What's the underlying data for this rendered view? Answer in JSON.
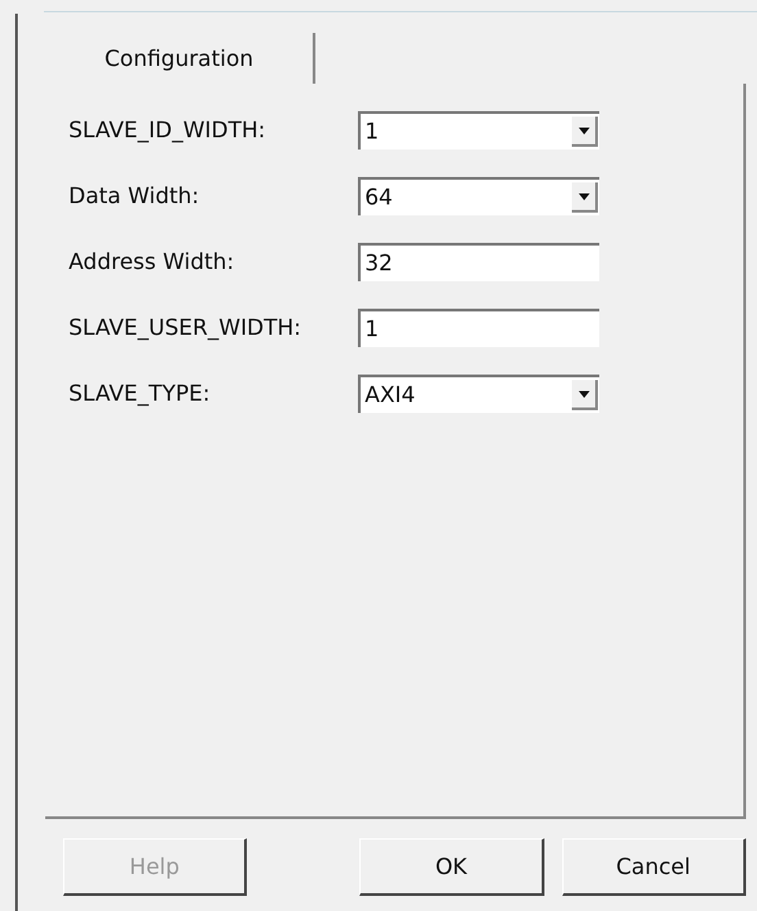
{
  "tabs": [
    {
      "label": "Configuration",
      "selected": true
    }
  ],
  "fields": [
    {
      "label": "SLAVE_ID_WIDTH:",
      "kind": "dropdown",
      "value": "1"
    },
    {
      "label": "Data Width:",
      "kind": "dropdown",
      "value": "64"
    },
    {
      "label": "Address Width:",
      "kind": "text",
      "value": "32"
    },
    {
      "label": "SLAVE_USER_WIDTH:",
      "kind": "text",
      "value": "1"
    },
    {
      "label": "SLAVE_TYPE:",
      "kind": "dropdown",
      "value": "AXI4"
    }
  ],
  "buttons": [
    {
      "label": "Help",
      "disabled": true
    },
    {
      "label": "OK",
      "disabled": false
    },
    {
      "label": "Cancel",
      "disabled": false
    }
  ]
}
